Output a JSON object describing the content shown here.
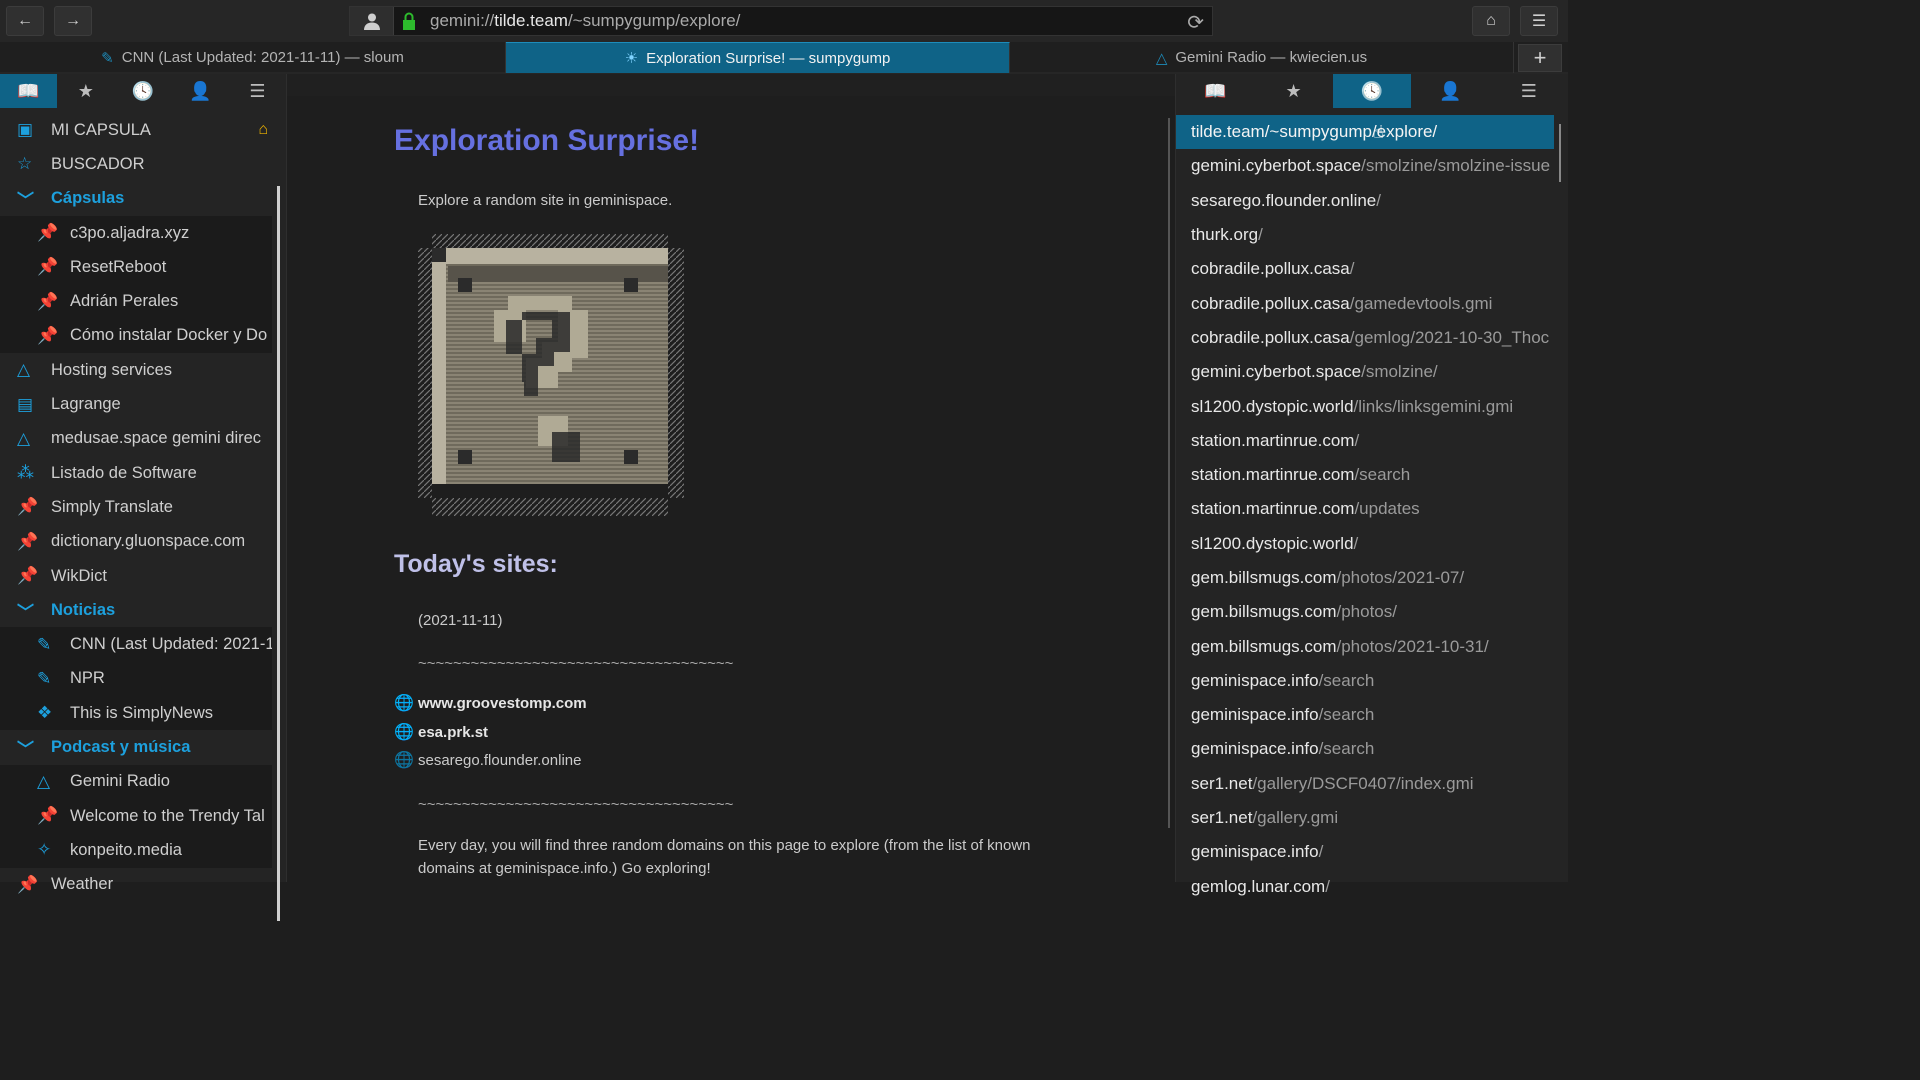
{
  "toolbar": {
    "back_icon": "←",
    "forward_icon": "→",
    "url_scheme": "gemini://",
    "url_host": "tilde.team",
    "url_path": "/~sumpygump/explore/",
    "reload_icon": "⟳",
    "home_icon": "⌂",
    "menu_icon": "☰"
  },
  "tabs": [
    {
      "icon": "✎",
      "label": "CNN (Last Updated: 2021-11-11) — sloum"
    },
    {
      "icon": "☀",
      "label": "Exploration Surprise! — sumpygump"
    },
    {
      "icon": "△",
      "label": "Gemini Radio — kwiecien.us"
    }
  ],
  "new_tab_icon": "+",
  "sidebar_tabs": [
    "📖",
    "★",
    "🕓",
    "👤",
    "☰"
  ],
  "bookmarks": [
    {
      "icon": "▣",
      "label": "MI CAPSULA",
      "type": "item",
      "home": "⌂"
    },
    {
      "icon": "☆",
      "label": "BUSCADOR",
      "type": "item"
    },
    {
      "icon": "﹀",
      "label": "Cápsulas",
      "type": "folder"
    },
    {
      "icon": "📌",
      "label": "c3po.aljadra.xyz",
      "type": "child"
    },
    {
      "icon": "📌",
      "label": "ResetReboot",
      "type": "child"
    },
    {
      "icon": "📌",
      "label": "Adrián Perales",
      "type": "child"
    },
    {
      "icon": "📌",
      "label": "Cómo instalar Docker y Do",
      "type": "child"
    },
    {
      "icon": "△",
      "label": "Hosting services",
      "type": "item"
    },
    {
      "icon": "▤",
      "label": "Lagrange",
      "type": "item"
    },
    {
      "icon": "△",
      "label": "medusae.space gemini direc",
      "type": "item"
    },
    {
      "icon": "⁂",
      "label": "Listado de Software",
      "type": "item"
    },
    {
      "icon": "📌",
      "label": "Simply Translate",
      "type": "item"
    },
    {
      "icon": "📌",
      "label": "dictionary.gluonspace.com",
      "type": "item"
    },
    {
      "icon": "📌",
      "label": "WikDict",
      "type": "item"
    },
    {
      "icon": "﹀",
      "label": "Noticias",
      "type": "folder"
    },
    {
      "icon": "✎",
      "label": "CNN (Last Updated: 2021-1",
      "type": "child"
    },
    {
      "icon": "✎",
      "label": "NPR",
      "type": "child"
    },
    {
      "icon": "❖",
      "label": "This is SimplyNews",
      "type": "child"
    },
    {
      "icon": "﹀",
      "label": "Podcast y música",
      "type": "folder"
    },
    {
      "icon": "△",
      "label": "Gemini Radio",
      "type": "child"
    },
    {
      "icon": "📌",
      "label": "Welcome to the Trendy Tal",
      "type": "child"
    },
    {
      "icon": "✧",
      "label": "konpeito.media",
      "type": "child"
    },
    {
      "icon": "📌",
      "label": "Weather",
      "type": "item"
    }
  ],
  "page": {
    "title": "Exploration Surprise!",
    "intro": "Explore a random site in geminispace.",
    "subtitle": "Today's sites:",
    "date": "(2021-11-11)",
    "separator": "~~~~~~~~~~~~~~~~~~~~~~~~~~~~~~~~~~~~",
    "links": [
      {
        "text": "www.groovestomp.com",
        "visited": false
      },
      {
        "text": "esa.prk.st",
        "visited": false
      },
      {
        "text": "sesarego.flounder.online",
        "visited": true
      }
    ],
    "footer_line1": "Every day, you will find three random domains on this page to explore (from the list of known",
    "footer_line2": "domains at geminispace.info.) Go exploring!"
  },
  "history": [
    {
      "host": "tilde.team",
      "path": "/~sumpygump/explore/"
    },
    {
      "host": "gemini.cyberbot.space",
      "path": "/smolzine/smolzine-issue"
    },
    {
      "host": "sesarego.flounder.online",
      "path": "/"
    },
    {
      "host": "thurk.org",
      "path": "/"
    },
    {
      "host": "cobradile.pollux.casa",
      "path": "/"
    },
    {
      "host": "cobradile.pollux.casa",
      "path": "/gamedevtools.gmi"
    },
    {
      "host": "cobradile.pollux.casa",
      "path": "/gemlog/2021-10-30_Thoc"
    },
    {
      "host": "gemini.cyberbot.space",
      "path": "/smolzine/"
    },
    {
      "host": "sl1200.dystopic.world",
      "path": "/links/linksgemini.gmi"
    },
    {
      "host": "station.martinrue.com",
      "path": "/"
    },
    {
      "host": "station.martinrue.com",
      "path": "/search"
    },
    {
      "host": "station.martinrue.com",
      "path": "/updates"
    },
    {
      "host": "sl1200.dystopic.world",
      "path": "/"
    },
    {
      "host": "gem.billsmugs.com",
      "path": "/photos/2021-07/"
    },
    {
      "host": "gem.billsmugs.com",
      "path": "/photos/"
    },
    {
      "host": "gem.billsmugs.com",
      "path": "/photos/2021-10-31/"
    },
    {
      "host": "geminispace.info",
      "path": "/search"
    },
    {
      "host": "geminispace.info",
      "path": "/search"
    },
    {
      "host": "geminispace.info",
      "path": "/search"
    },
    {
      "host": "ser1.net",
      "path": "/gallery/DSCF0407/index.gmi"
    },
    {
      "host": "ser1.net",
      "path": "/gallery.gmi"
    },
    {
      "host": "geminispace.info",
      "path": "/"
    },
    {
      "host": "gemlog.lunar.com",
      "path": "/"
    }
  ]
}
